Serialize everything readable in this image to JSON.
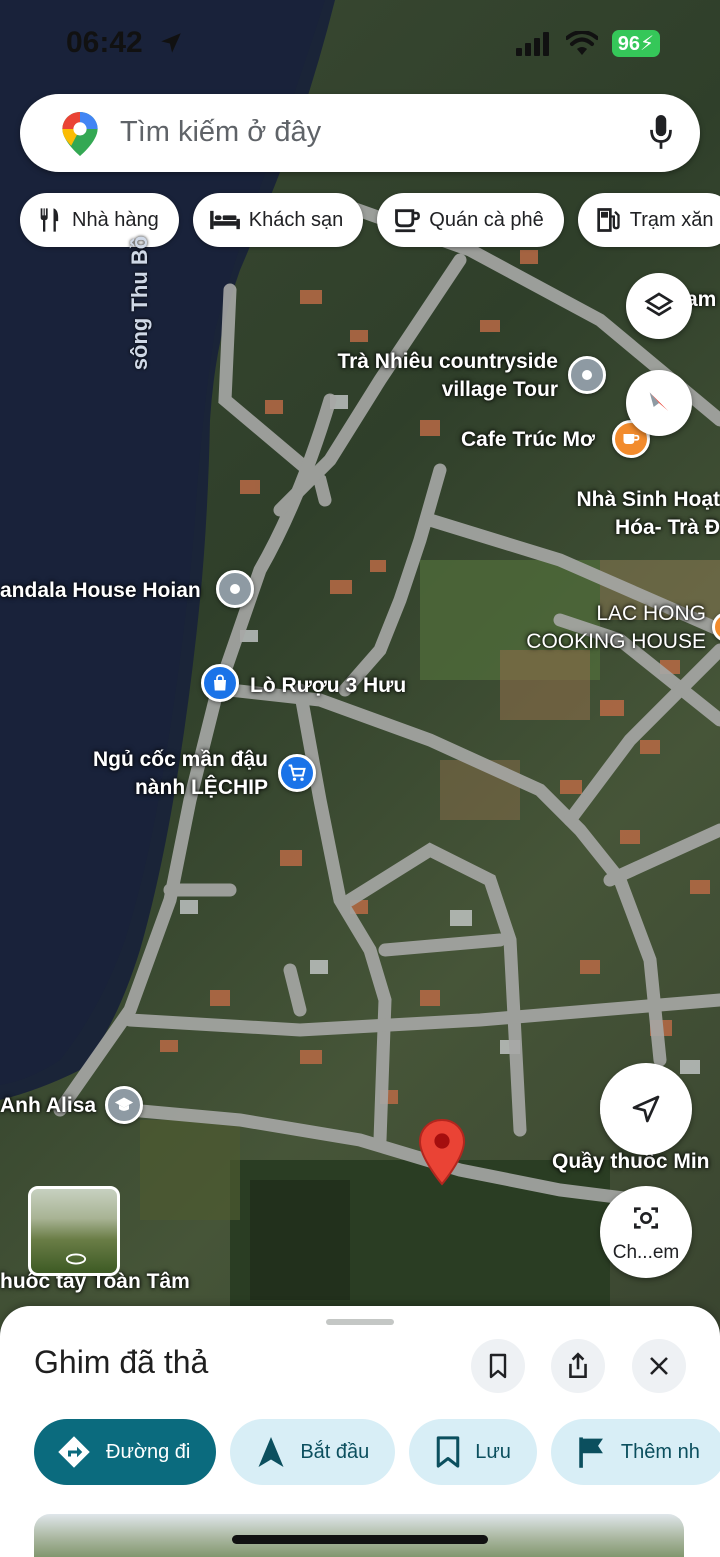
{
  "status_bar": {
    "time": "06:42",
    "battery": "96"
  },
  "search": {
    "placeholder": "Tìm kiếm ở đây",
    "logo_icon": "google-maps-pin-icon",
    "mic_icon": "mic-icon"
  },
  "chips": [
    {
      "label": "Nhà hàng",
      "icon": "fork-knife-icon"
    },
    {
      "label": "Khách sạn",
      "icon": "bed-icon"
    },
    {
      "label": "Quán cà phê",
      "icon": "coffee-cup-icon"
    },
    {
      "label": "Trạm xăn",
      "icon": "gas-pump-icon"
    }
  ],
  "map": {
    "river_label": "sông Thu Bồ",
    "labels": {
      "tour_line1": "Trà Nhiêu countryside",
      "tour_line2": "village Tour",
      "cafe": "Cafe Trúc Mơ",
      "culture_line1": "Nhà Sinh Hoạt",
      "culture_line2": "Hóa- Trà Đ",
      "house": "andala House Hoian",
      "cooking_line1": "LAC HONG",
      "cooking_line2": "COOKING HOUSE",
      "wine": "Lò Rượu 3 Hưu",
      "cereal_line1": "Ngủ cốc mần đậu",
      "cereal_line2": "nành LỆCHIP",
      "school": "Anh Alisa",
      "pharmacy_left": "huốc tây Toàn Tâm",
      "pharmacy_right": "Quầy thuốc Min",
      "top_right": "am"
    },
    "camera_button_label": "Ch...em"
  },
  "colors": {
    "accent": "#0b6b7e",
    "pin_red": "#ea4335",
    "cafe_orange": "#f28b2c",
    "shop_blue": "#1a73e8"
  },
  "sheet": {
    "title": "Ghim đã thả",
    "actions": [
      {
        "label": "Đường đi",
        "icon": "directions-icon"
      },
      {
        "label": "Bắt đầu",
        "icon": "navigation-arrow-icon"
      },
      {
        "label": "Lưu",
        "icon": "bookmark-icon"
      },
      {
        "label": "Thêm nh",
        "icon": "flag-icon"
      }
    ]
  }
}
